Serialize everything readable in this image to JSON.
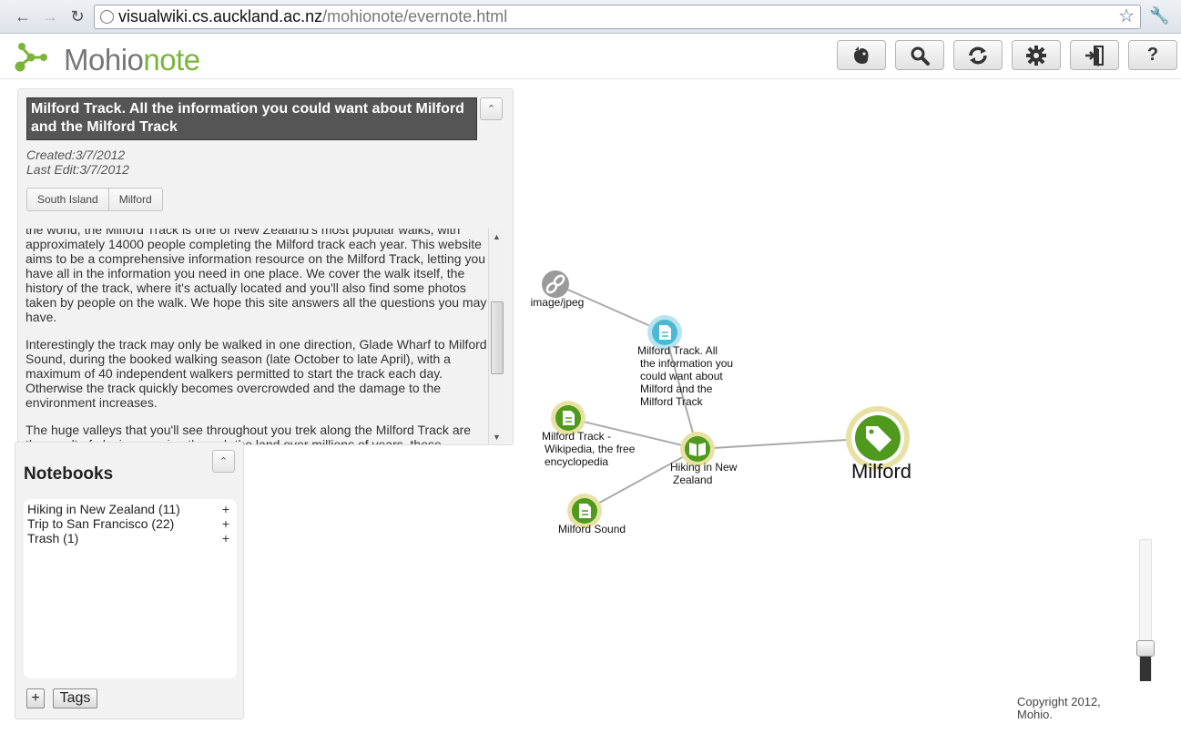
{
  "browser": {
    "url_host": "visualwiki.cs.auckland.ac.nz",
    "url_path": "/mohionote/evernote.html",
    "back_icon": "arrow-left-icon",
    "forward_icon": "arrow-right-icon",
    "reload_icon": "reload-icon"
  },
  "app": {
    "logo_main": "Mohio",
    "logo_accent": "note",
    "accent_color": "#7ab53a",
    "toolbar": [
      "evernote-icon",
      "search-icon",
      "sync-icon",
      "gear-icon",
      "exit-icon",
      "help-icon"
    ],
    "help_label": "?"
  },
  "note": {
    "title": "Milford Track. All the information you could want about Milford and the Milford Track",
    "created": "Created:3/7/2012",
    "last_edit": "Last Edit:3/7/2012",
    "tags": [
      "South Island",
      "Milford"
    ],
    "paragraphs": [
      "the world, the Milford Track is one of New Zealand's most popular walks, with approximately 14000 people completing the Milford track each year. This website aims to be a comprehensive information resource on the Milford Track, letting you have all in the information you need in one place. We cover the walk itself, the history of the track, where it's actually located and you'll also find some photos taken by people on the walk. We hope this site answers all the questions you may have.",
      "Interestingly the track may only be walked in one direction, Glade Wharf to Milford Sound, during the booked walking season (late October to late April), with a maximum of 40 independent walkers permitted to start the track each day. Otherwise the track quickly becomes overcrowded and the damage to the environment increases.",
      "The huge valleys that you'll see throughout you trek along the Milford Track are the result of glaciers carving through the land over millions of years, these glaciers carved"
    ]
  },
  "notebooks": {
    "title": "Notebooks",
    "items": [
      {
        "label": "Hiking in New Zealand (11)",
        "plus": "+"
      },
      {
        "label": "Trip to San Francisco (22)",
        "plus": "+"
      },
      {
        "label": "Trash (1)",
        "plus": "+"
      }
    ],
    "add_label": "+",
    "tags_label": "Tags"
  },
  "graph": {
    "nodes": {
      "image": "image/jpeg",
      "note_main": [
        "Milford Track. All",
        "the information you",
        "could want about",
        "Milford and the",
        "Milford Track"
      ],
      "wiki": [
        "Milford Track -",
        "Wikipedia, the free",
        "encyclopedia"
      ],
      "hiking": [
        "Hiking in New",
        "Zealand"
      ],
      "sound": "Milford Sound",
      "milford": "Milford"
    },
    "colors": {
      "green": "#4f9a1c",
      "halo": "#e8e1a4",
      "blue": "#4cb8d4",
      "gray": "#9a9a9a"
    }
  },
  "footer": {
    "copyright_1": "Copyright 2012,",
    "copyright_2": "Mohio."
  }
}
